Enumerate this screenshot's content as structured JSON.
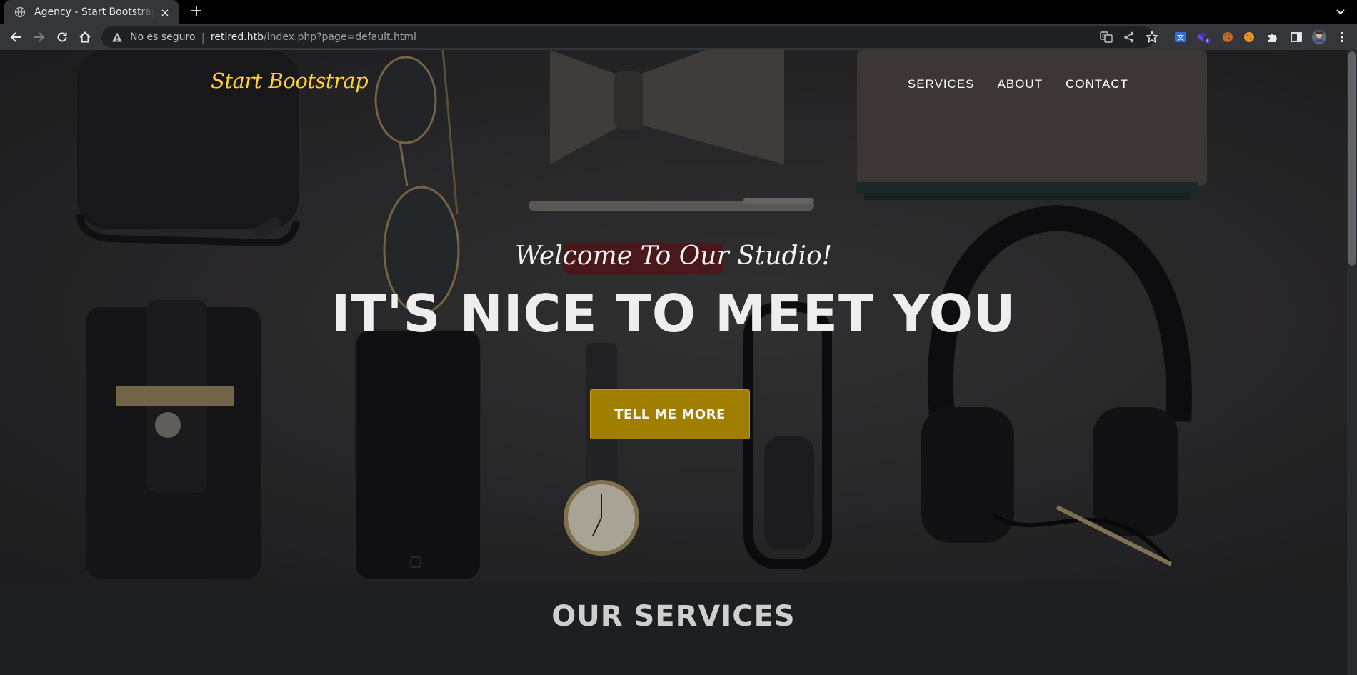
{
  "browser": {
    "tab_title": "Agency - Start Bootstrap Theme",
    "tab_close": "×",
    "new_tab": "+",
    "security_label": "No es seguro",
    "url_host": "retired.htb",
    "url_path": "/index.php?page=default.html",
    "extension_badge": "6",
    "icons": [
      "back-icon",
      "forward-icon",
      "reload-icon",
      "home-icon",
      "warning-icon",
      "translate-icon",
      "share-icon",
      "star-icon",
      "extension-icon",
      "sidebar-icon",
      "profile-icon",
      "menu-icon"
    ]
  },
  "navbar": {
    "brand": "Start Bootstrap",
    "links": [
      "SERVICES",
      "ABOUT",
      "CONTACT"
    ]
  },
  "hero": {
    "subheading": "Welcome To Our Studio!",
    "heading": "IT'S NICE TO MEET YOU",
    "button": "TELL ME MORE"
  },
  "services": {
    "title": "OUR SERVICES"
  },
  "colors": {
    "brand": "#fed136",
    "button": "#a07f00",
    "page_bg": "#212529",
    "chrome": "#35363a"
  }
}
